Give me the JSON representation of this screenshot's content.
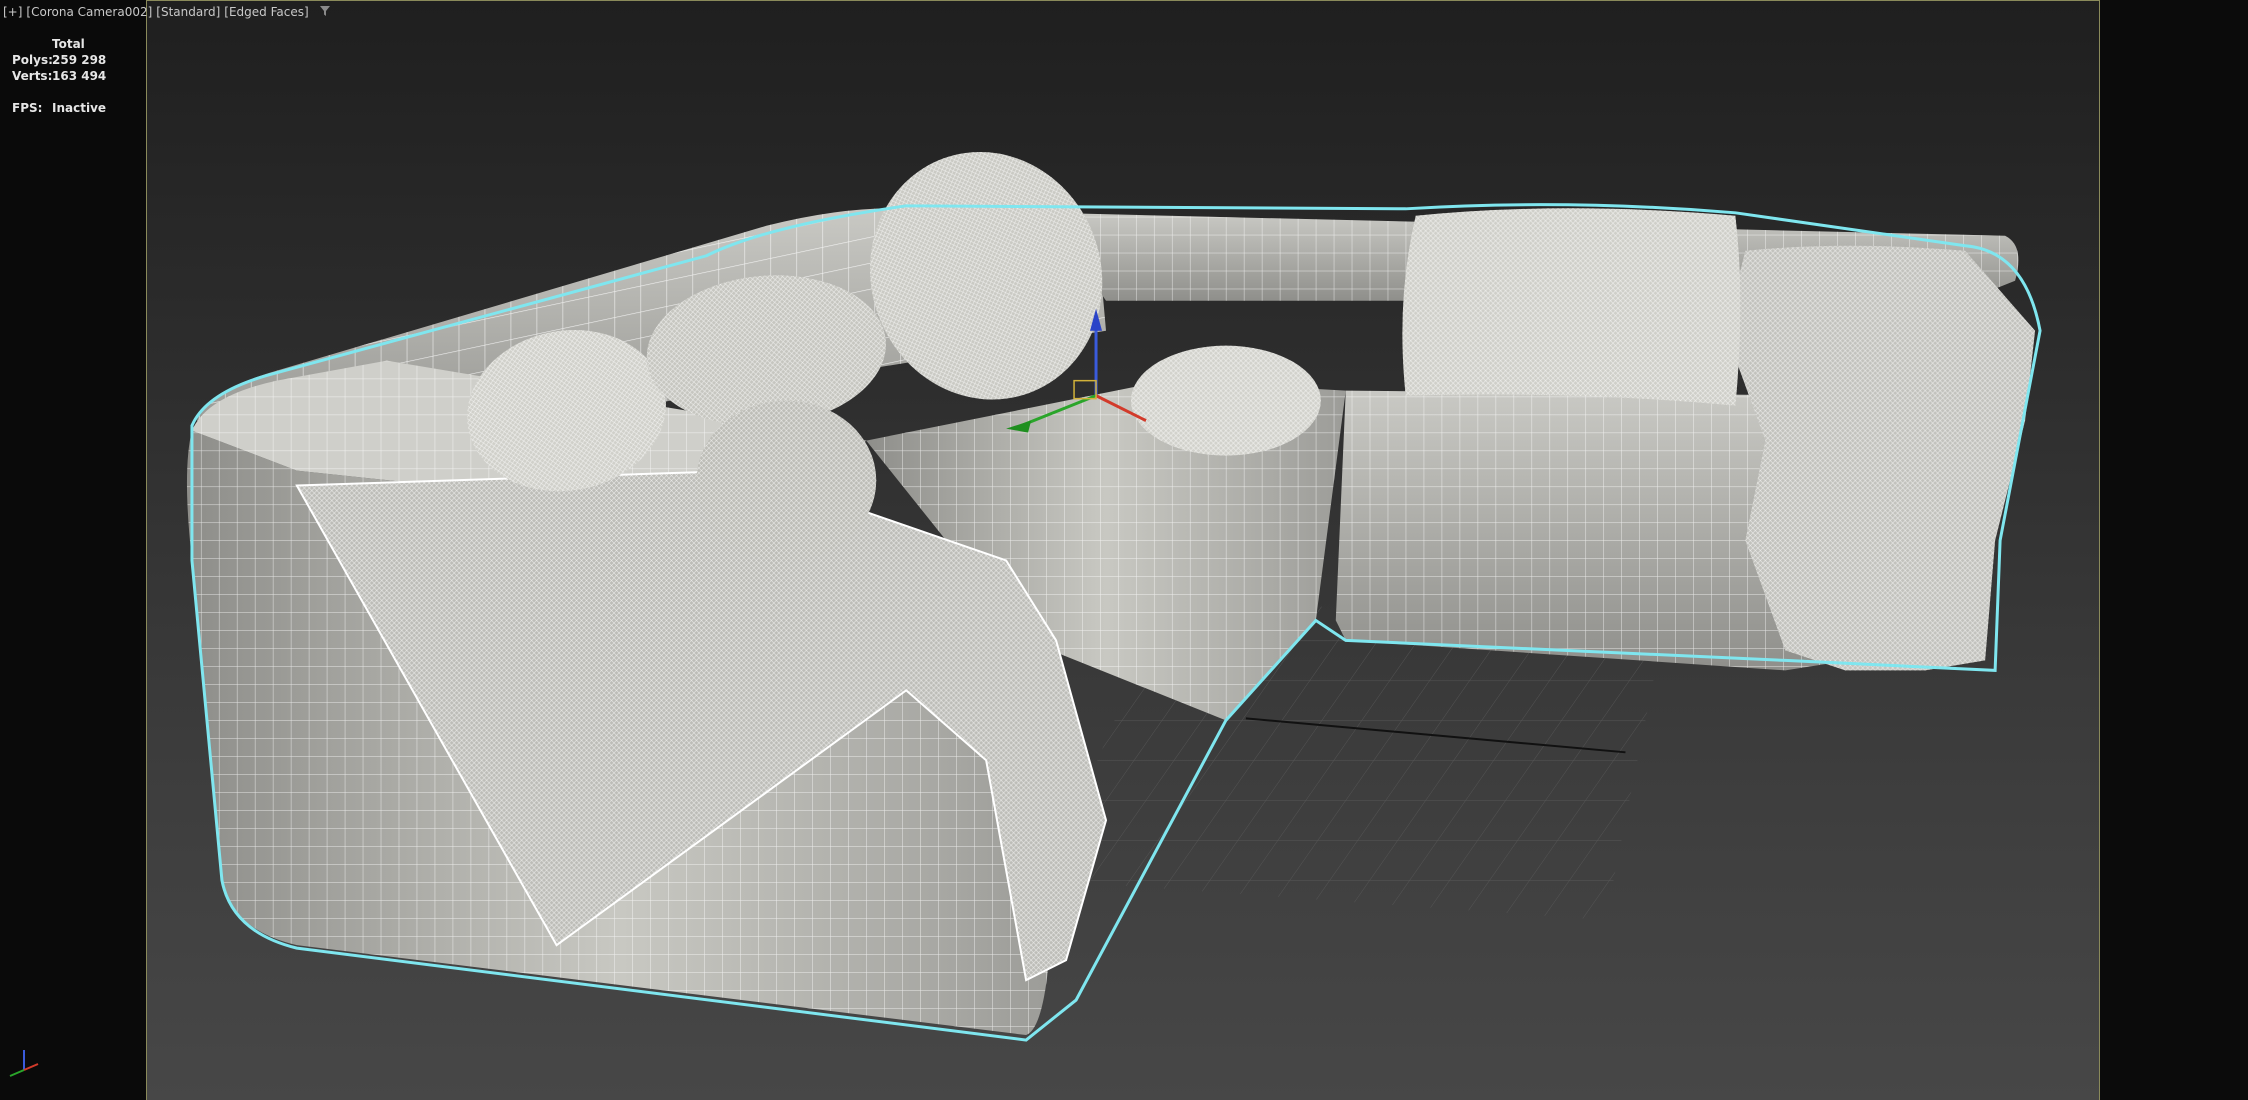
{
  "viewport": {
    "label_parts": [
      "[+]",
      "[Corona Camera002]",
      "[Standard]",
      "[Edged Faces]"
    ]
  },
  "stats": {
    "header": "Total",
    "polys_label": "Polys:",
    "polys_value": "259 298",
    "verts_label": "Verts:",
    "verts_value": "163 494",
    "fps_label": "FPS:",
    "fps_value": "Inactive"
  },
  "colors": {
    "selection_outline": "#7fe6ef",
    "viewport_border": "#8a8a5a",
    "mesh_fill": "#b9b9b4",
    "wire": "#ffffff"
  },
  "icons": {
    "filter": "filter-icon",
    "gizmo": "transform-gizmo-icon",
    "axis": "axis-tripod-icon"
  }
}
